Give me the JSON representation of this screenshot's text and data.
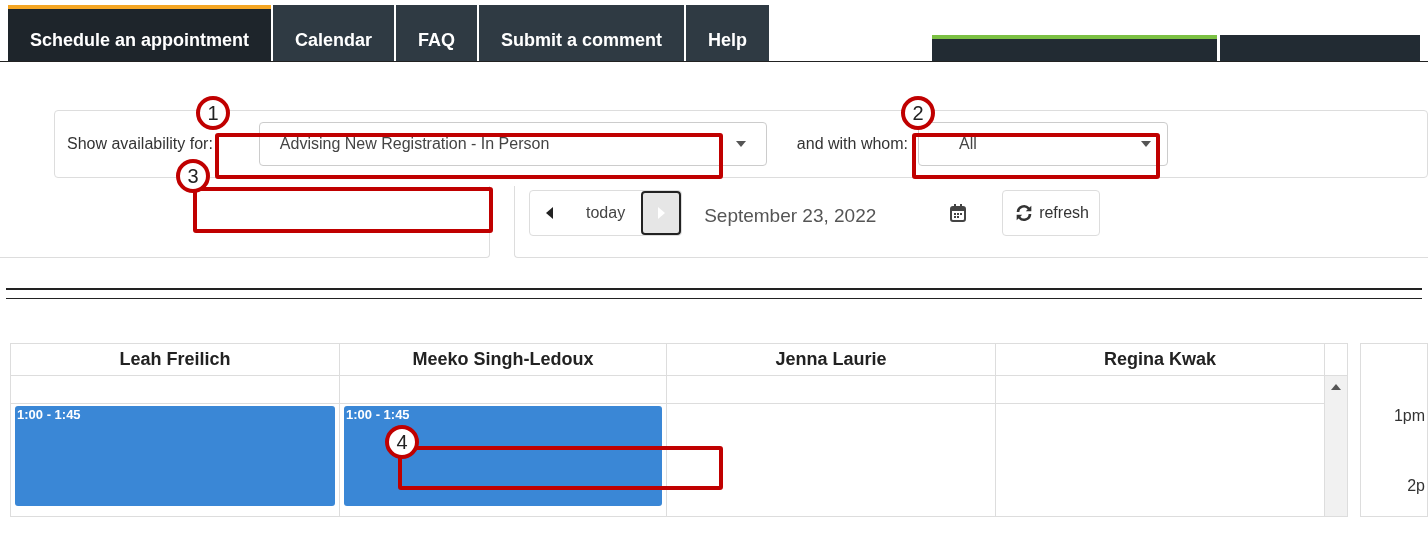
{
  "tabs": [
    {
      "label": "Schedule an appointment",
      "selected": true
    },
    {
      "label": "Calendar",
      "selected": false
    },
    {
      "label": "FAQ",
      "selected": false
    },
    {
      "label": "Submit a comment",
      "selected": false
    },
    {
      "label": "Help",
      "selected": false
    }
  ],
  "filters": {
    "service_label": "Show availability for:",
    "service_value": "Advising New Registration - In Person",
    "staff_label": "and with whom:",
    "staff_value": "All"
  },
  "navigation": {
    "today": "today",
    "date": "September 23, 2022",
    "refresh": "refresh"
  },
  "calendar": {
    "columns": [
      {
        "name": "Leah Freilich",
        "events": [
          {
            "time": "1:00 - 1:45"
          }
        ]
      },
      {
        "name": "Meeko Singh-Ledoux",
        "events": [
          {
            "time": "1:00 - 1:45"
          }
        ]
      },
      {
        "name": "Jenna Laurie"
      },
      {
        "name": "Regina Kwak"
      }
    ],
    "time_labels": [
      "1pm",
      "2p"
    ]
  },
  "callouts": [
    {
      "number": "1"
    },
    {
      "number": "2"
    },
    {
      "number": "3"
    },
    {
      "number": "4"
    }
  ]
}
